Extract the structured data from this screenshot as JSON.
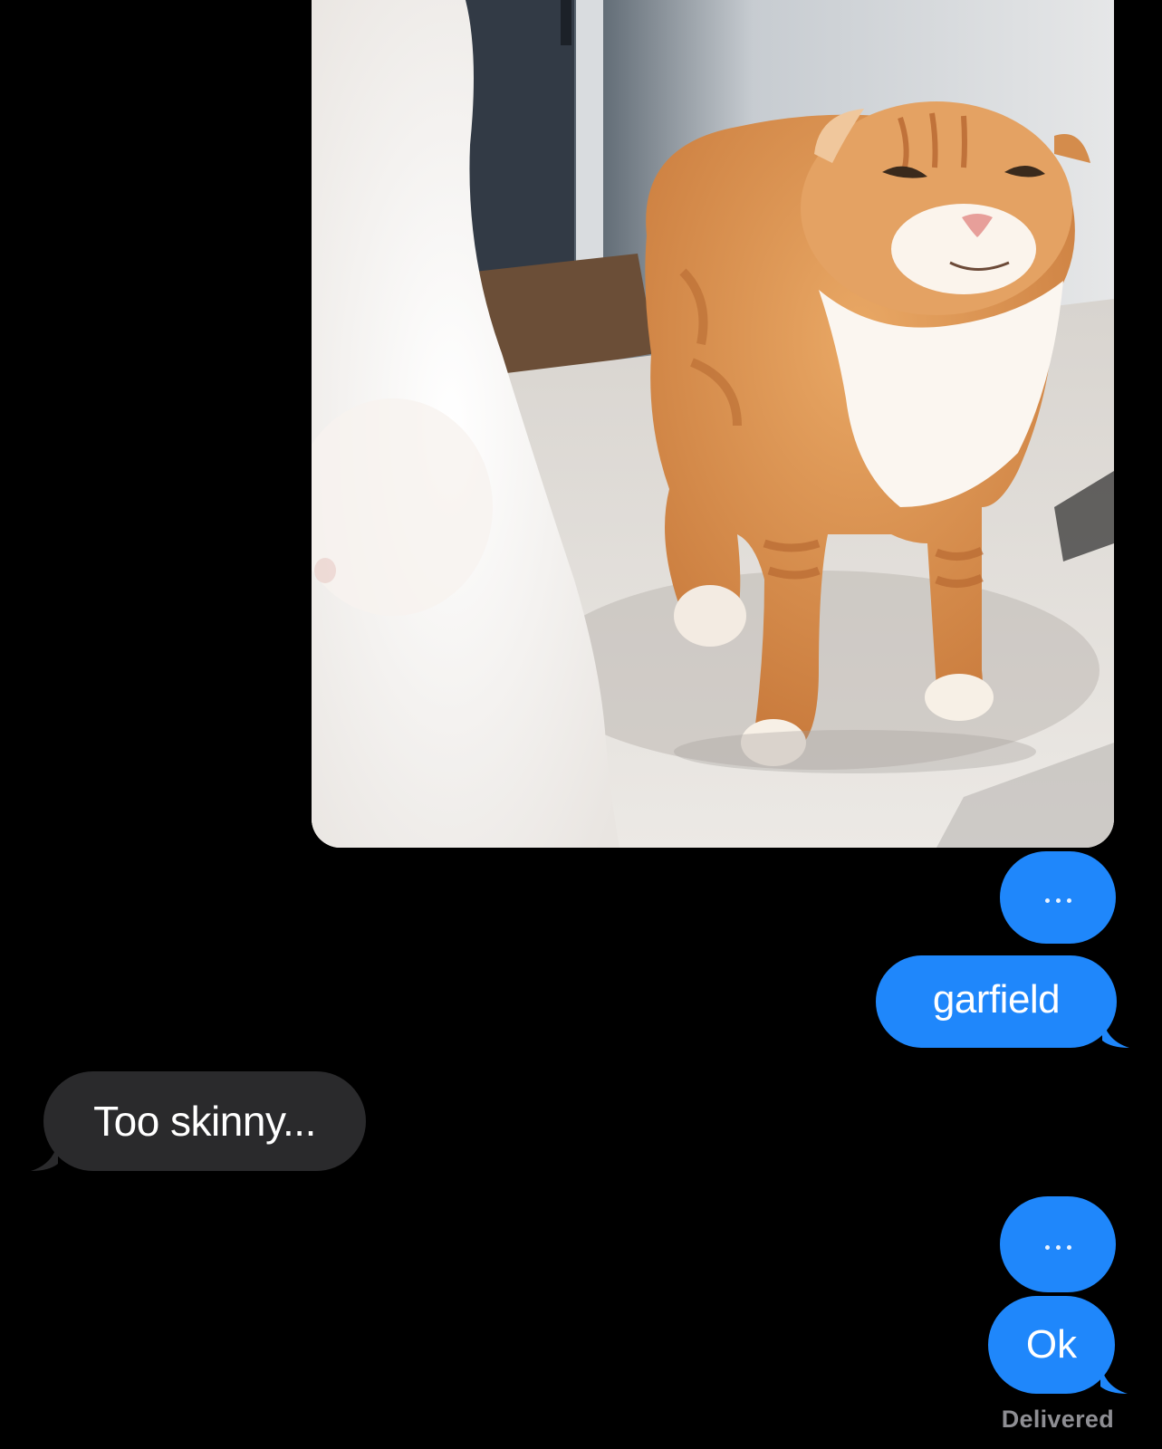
{
  "conversation": {
    "photo": {
      "description_icon": "photo-message"
    },
    "messages": [
      {
        "sender": "me",
        "type": "typing",
        "text": "..."
      },
      {
        "sender": "me",
        "type": "text",
        "text": "garfield"
      },
      {
        "sender": "them",
        "type": "text",
        "text": "Too skinny..."
      },
      {
        "sender": "me",
        "type": "typing",
        "text": "..."
      },
      {
        "sender": "me",
        "type": "text",
        "text": "Ok"
      }
    ],
    "status": "Delivered"
  },
  "colors": {
    "background": "#000000",
    "outgoing_bubble": "#1f87fb",
    "incoming_bubble": "#2a2a2c",
    "status_text": "#8e8e93"
  }
}
